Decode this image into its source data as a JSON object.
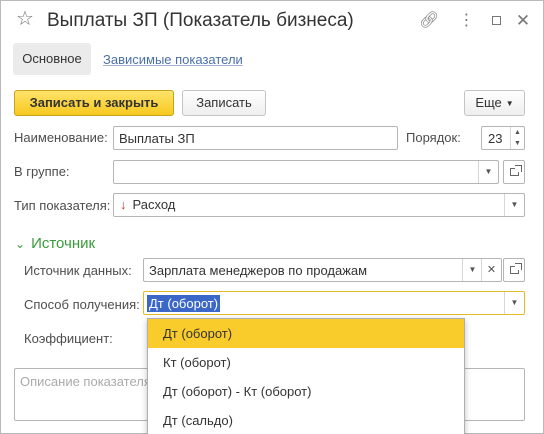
{
  "window": {
    "title": "Выплаты ЗП (Показатель бизнеса)"
  },
  "tabs": [
    {
      "label": "Основное",
      "active": true
    },
    {
      "label": "Зависимые показатели",
      "active": false
    }
  ],
  "toolbar": {
    "save_close_label": "Записать и закрыть",
    "save_label": "Записать",
    "more_label": "Еще"
  },
  "form": {
    "name_label": "Наименование:",
    "name_value": "Выплаты ЗП",
    "order_label": "Порядок:",
    "order_value": "23",
    "group_label": "В группе:",
    "group_value": "",
    "type_label": "Тип показателя:",
    "type_value": "Расход",
    "section_title": "Источник",
    "source_label": "Источник данных:",
    "source_value": "Зарплата менеджеров по продажам",
    "method_label": "Способ получения:",
    "method_value": "Дт (оборот)",
    "coef_label": "Коэффициент:",
    "description_placeholder": "Описание показателя"
  },
  "dropdown": {
    "options": [
      "Дт (оборот)",
      "Кт (оборот)",
      "Дт (оборот) - Кт (оборот)",
      "Дт (сальдо)"
    ],
    "selected_index": 0
  },
  "colors": {
    "primary_button": "#f6c91f",
    "highlight": "#f9cc2b",
    "link": "#4b6fa7",
    "section": "#3a9a3a",
    "expense_arrow": "#d9352c",
    "selection": "#3b67c8"
  },
  "icons": {
    "favorite": "star-icon",
    "link": "link-icon",
    "more": "more-icon",
    "maximize": "maximize-icon",
    "close": "close-icon"
  }
}
